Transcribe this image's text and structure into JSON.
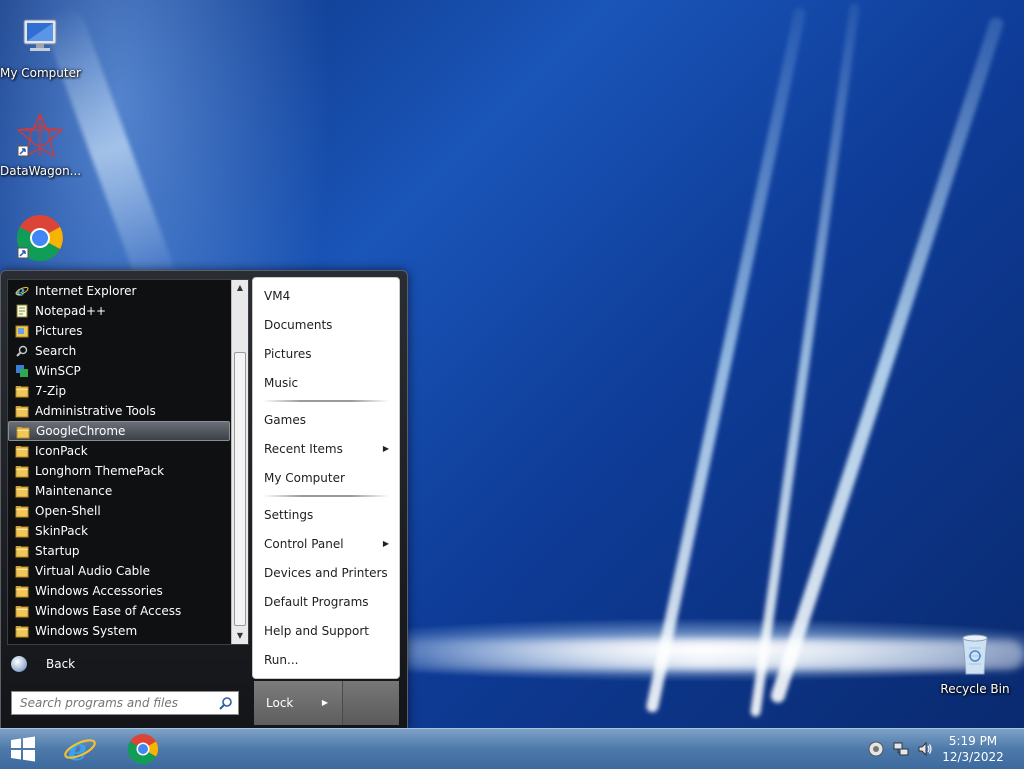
{
  "desktop_icons": [
    {
      "label": "My Computer",
      "icon": "monitor-icon"
    },
    {
      "label": "DataWagon...",
      "icon": "datawagon-icon"
    },
    {
      "label": "",
      "icon": "chrome-icon"
    },
    {
      "label": "Recycle Bin",
      "icon": "recycle-bin-icon"
    }
  ],
  "start_menu": {
    "programs": [
      {
        "label": "Internet Explorer",
        "icon": "internet-explorer-icon"
      },
      {
        "label": "Notepad++",
        "icon": "notepad-icon"
      },
      {
        "label": "Pictures",
        "icon": "pictures-icon"
      },
      {
        "label": "Search",
        "icon": "search-icon"
      },
      {
        "label": "WinSCP",
        "icon": "winscp-icon"
      },
      {
        "label": "7-Zip",
        "icon": "folder-icon"
      },
      {
        "label": "Administrative Tools",
        "icon": "folder-icon"
      },
      {
        "label": "GoogleChrome",
        "icon": "folder-icon"
      },
      {
        "label": "IconPack",
        "icon": "folder-icon"
      },
      {
        "label": "Longhorn ThemePack",
        "icon": "folder-icon"
      },
      {
        "label": "Maintenance",
        "icon": "folder-icon"
      },
      {
        "label": "Open-Shell",
        "icon": "folder-icon"
      },
      {
        "label": "SkinPack",
        "icon": "folder-icon"
      },
      {
        "label": "Startup",
        "icon": "folder-icon"
      },
      {
        "label": "Virtual Audio Cable",
        "icon": "folder-icon"
      },
      {
        "label": "Windows Accessories",
        "icon": "folder-icon"
      },
      {
        "label": "Windows Ease of Access",
        "icon": "folder-icon"
      },
      {
        "label": "Windows System",
        "icon": "folder-icon"
      }
    ],
    "selected_program": "GoogleChrome",
    "back_label": "Back",
    "search_placeholder": "Search programs and files",
    "right_items": {
      "vm4": "VM4",
      "documents": "Documents",
      "pictures": "Pictures",
      "music": "Music",
      "games": "Games",
      "recent_items": "Recent Items",
      "my_computer": "My Computer",
      "settings": "Settings",
      "control_panel": "Control Panel",
      "devices_printers": "Devices and Printers",
      "default_programs": "Default Programs",
      "help_support": "Help and Support",
      "run": "Run..."
    },
    "lock_label": "Lock"
  },
  "taskbar": {
    "pinned": [
      "internet-explorer-icon",
      "chrome-icon"
    ],
    "tray_icons": [
      "circle-status-icon",
      "network-icon",
      "speaker-icon"
    ],
    "time": "5:19 PM",
    "date": "12/3/2022"
  },
  "colors": {
    "taskbar": "#4d79aa",
    "start_menu_bg": "#1d1f23",
    "selection": "#5a5e66",
    "folder": "#f0c75a"
  }
}
